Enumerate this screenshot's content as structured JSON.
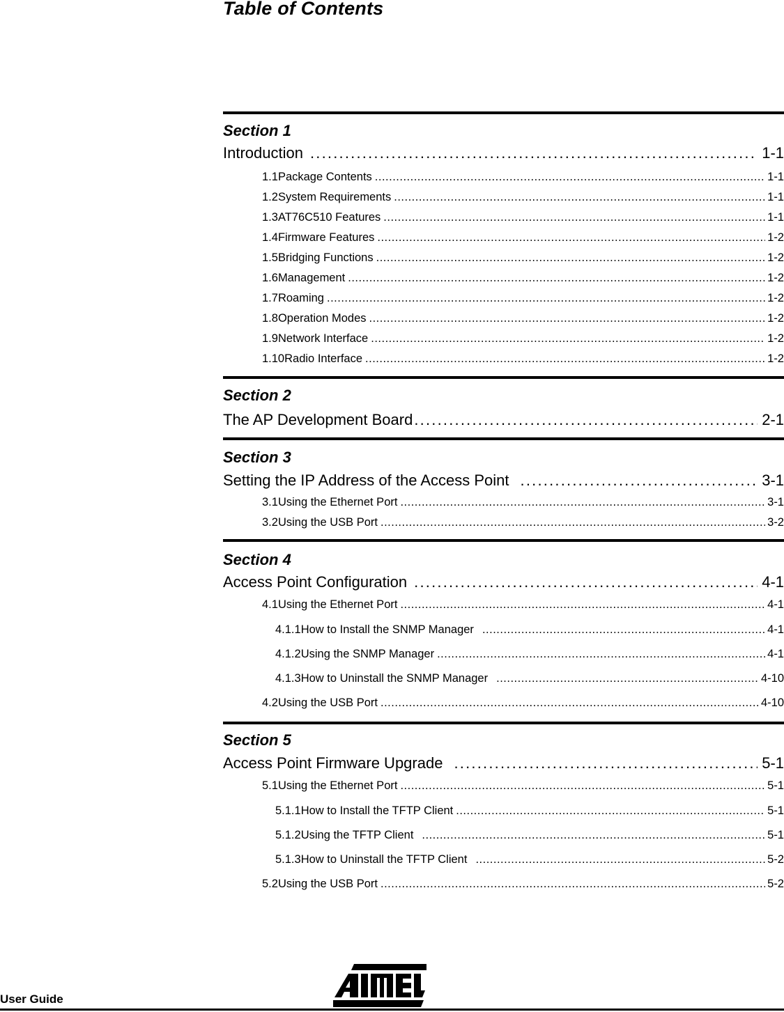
{
  "page": {
    "title": "Table of Contents"
  },
  "sections": [
    {
      "label": "Section 1",
      "title": "Introduction",
      "page": "1-1",
      "entries": [
        {
          "num": "1.1",
          "title": "Package Contents",
          "page": "1-1"
        },
        {
          "num": "1.2",
          "title": "System Requirements",
          "page": "1-1"
        },
        {
          "num": "1.3",
          "title": "AT76C510 Features",
          "page": "1-1"
        },
        {
          "num": "1.4",
          "title": "Firmware Features",
          "page": "1-2"
        },
        {
          "num": "1.5",
          "title": "Bridging Functions",
          "page": "1-2"
        },
        {
          "num": "1.6",
          "title": "Management",
          "page": "1-2"
        },
        {
          "num": "1.7",
          "title": "Roaming",
          "page": "1-2"
        },
        {
          "num": "1.8",
          "title": "Operation Modes",
          "page": "1-2"
        },
        {
          "num": "1.9",
          "title": "Network Interface",
          "page": "1-2"
        },
        {
          "num": "1.10",
          "title": "Radio Interface",
          "page": "1-2"
        }
      ]
    },
    {
      "label": "Section 2",
      "title": "The AP Development Board",
      "page": "2-1",
      "entries": []
    },
    {
      "label": "Section 3",
      "title": "Setting the IP Address of the Access Point",
      "page": "3-1",
      "entries": [
        {
          "num": "3.1",
          "title": "Using the Ethernet Port",
          "page": "3-1"
        },
        {
          "num": "3.2",
          "title": "Using the USB Port",
          "page": "3-2"
        }
      ]
    },
    {
      "label": "Section 4",
      "title": "Access Point Configuration",
      "page": "4-1",
      "entries": [
        {
          "num": "4.1",
          "title": "Using the Ethernet Port",
          "page": "4-1"
        },
        {
          "num": "4.1.1",
          "title": "How to Install the SNMP Manager",
          "page": "4-1"
        },
        {
          "num": "4.1.2",
          "title": "Using the SNMP Manager",
          "page": "4-1"
        },
        {
          "num": "4.1.3",
          "title": "How to Uninstall the SNMP Manager",
          "page": "4-10"
        },
        {
          "num": "4.2",
          "title": "Using the USB Port",
          "page": "4-10"
        }
      ]
    },
    {
      "label": "Section 5",
      "title": "Access Point Firmware Upgrade",
      "page": "5-1",
      "entries": [
        {
          "num": "5.1",
          "title": "Using the Ethernet Port",
          "page": "5-1"
        },
        {
          "num": "5.1.1",
          "title": "How to Install the TFTP Client",
          "page": "5-1"
        },
        {
          "num": "5.1.2",
          "title": "Using the TFTP Client",
          "page": "5-1"
        },
        {
          "num": "5.1.3",
          "title": "How to Uninstall the TFTP Client",
          "page": "5-2"
        },
        {
          "num": "5.2",
          "title": "Using the USB Port",
          "page": "5-2"
        }
      ]
    }
  ],
  "footer": {
    "label": "User Guide",
    "logo": "ATMEL"
  }
}
